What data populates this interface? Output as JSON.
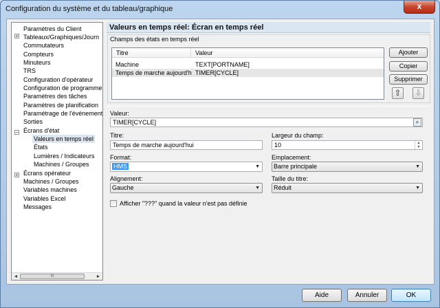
{
  "window": {
    "title": "Configuration du système et du tableau/graphique",
    "close_glyph": "x"
  },
  "tree": {
    "items": [
      {
        "label": "Paramètres du Client"
      },
      {
        "label": "Tableaux/Graphiques/Journ"
      },
      {
        "label": "Commutateurs"
      },
      {
        "label": "Compteurs"
      },
      {
        "label": "Minuteurs"
      },
      {
        "label": "TRS"
      },
      {
        "label": "Configuration d'opérateur"
      },
      {
        "label": "Configuration de programme"
      },
      {
        "label": "Paramètres des tâches"
      },
      {
        "label": "Paramètres de planification"
      },
      {
        "label": "Paramétrage de l'événement"
      },
      {
        "label": "Sorties"
      },
      {
        "label": "Écrans d'état"
      },
      {
        "label": "Valeurs en temps réel"
      },
      {
        "label": "États"
      },
      {
        "label": "Lumières / Indicateurs"
      },
      {
        "label": "Machines / Groupes"
      },
      {
        "label": "Écrans opérateur"
      },
      {
        "label": "Machines / Groupes"
      },
      {
        "label": "Variables machines"
      },
      {
        "label": "Variables Excel"
      },
      {
        "label": "Messages"
      }
    ],
    "scroll_left": "◄",
    "scroll_right": "►",
    "scroll_grip": "III"
  },
  "panel": {
    "header": "Valeurs en temps réel: Écran en temps réel",
    "group_label": "Champs des états en temps réel",
    "columns": [
      "Titre",
      "Valeur"
    ],
    "rows": [
      {
        "titre": "Machine",
        "valeur": "TEXT[PORTNAME]"
      },
      {
        "titre": "Temps de marche aujourd'hui",
        "valeur": "TIMER[CYCLE]"
      }
    ],
    "buttons": {
      "ajouter": "Ajouter",
      "copier": "Copier",
      "supprimer": "Supprimer",
      "up": "⇧",
      "down": "⇩"
    }
  },
  "form": {
    "valeur_label": "Valeur:",
    "valeur_value": "TIMER[CYCLE]",
    "titre_label": "Titre:",
    "titre_value": "Temps de marche aujourd'hui",
    "largeur_label": "Largeur du champ:",
    "largeur_value": "10",
    "format_label": "Format:",
    "format_value": "HMS",
    "emplacement_label": "Emplacement:",
    "emplacement_value": "Barre principale",
    "alignement_label": "Alignement:",
    "alignement_value": "Gauche",
    "taille_label": "Taille du titre:",
    "taille_value": "Réduit",
    "checkbox_label": "Afficher \"???\" quand la valeur n'est pas définie",
    "checkbox_checked": false
  },
  "footer": {
    "aide": "Aide",
    "annuler": "Annuler",
    "ok": "OK"
  }
}
